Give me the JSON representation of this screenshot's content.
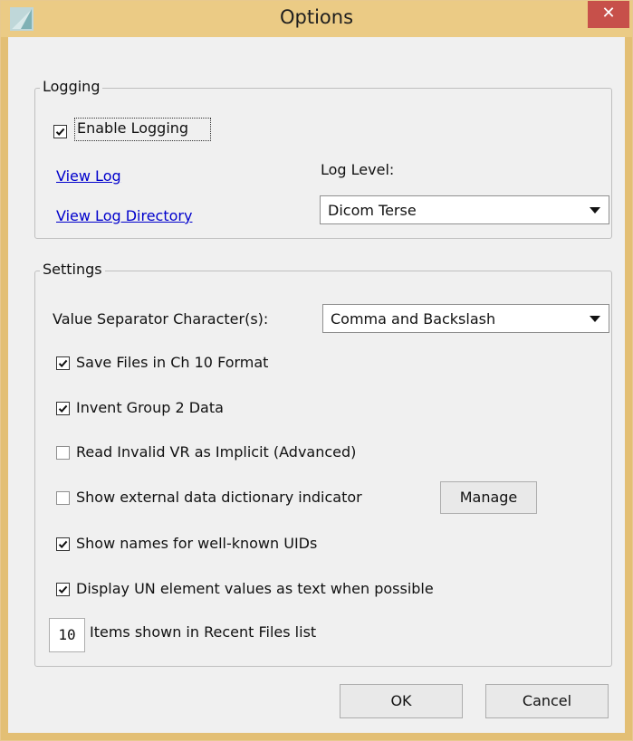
{
  "window": {
    "title": "Options",
    "close_glyph": "✕",
    "frame_color": "#e3bf74",
    "titlebar_color": "#ebcb85",
    "close_color": "#c7504a"
  },
  "logging": {
    "group_title": "Logging",
    "enable_logging": {
      "label": "Enable Logging",
      "checked": true
    },
    "view_log_link": "View Log",
    "view_log_directory_link": "View Log Directory",
    "log_level_label": "Log Level:",
    "log_level_value": "Dicom Terse",
    "link_color": "#0000cc"
  },
  "settings": {
    "group_title": "Settings",
    "value_separator_label": "Value Separator Character(s):",
    "value_separator_value": "Comma and Backslash",
    "options": [
      {
        "label": "Save Files in Ch 10 Format",
        "checked": true
      },
      {
        "label": "Invent Group 2 Data",
        "checked": true
      },
      {
        "label": "Read Invalid VR as Implicit (Advanced)",
        "checked": false
      },
      {
        "label": "Show external data dictionary indicator",
        "checked": false
      },
      {
        "label": "Show names for well-known UIDs",
        "checked": true
      },
      {
        "label": "Display UN element values as text when possible",
        "checked": true
      }
    ],
    "manage_button": "Manage",
    "recent_files_count": "10",
    "recent_files_label": "Items shown in Recent Files list"
  },
  "footer": {
    "ok_button": "OK",
    "cancel_button": "Cancel"
  },
  "icons": {
    "app": "app-logo-icon",
    "close": "close-icon",
    "dropdown": "chevron-down-icon",
    "check": "checkmark-icon"
  }
}
